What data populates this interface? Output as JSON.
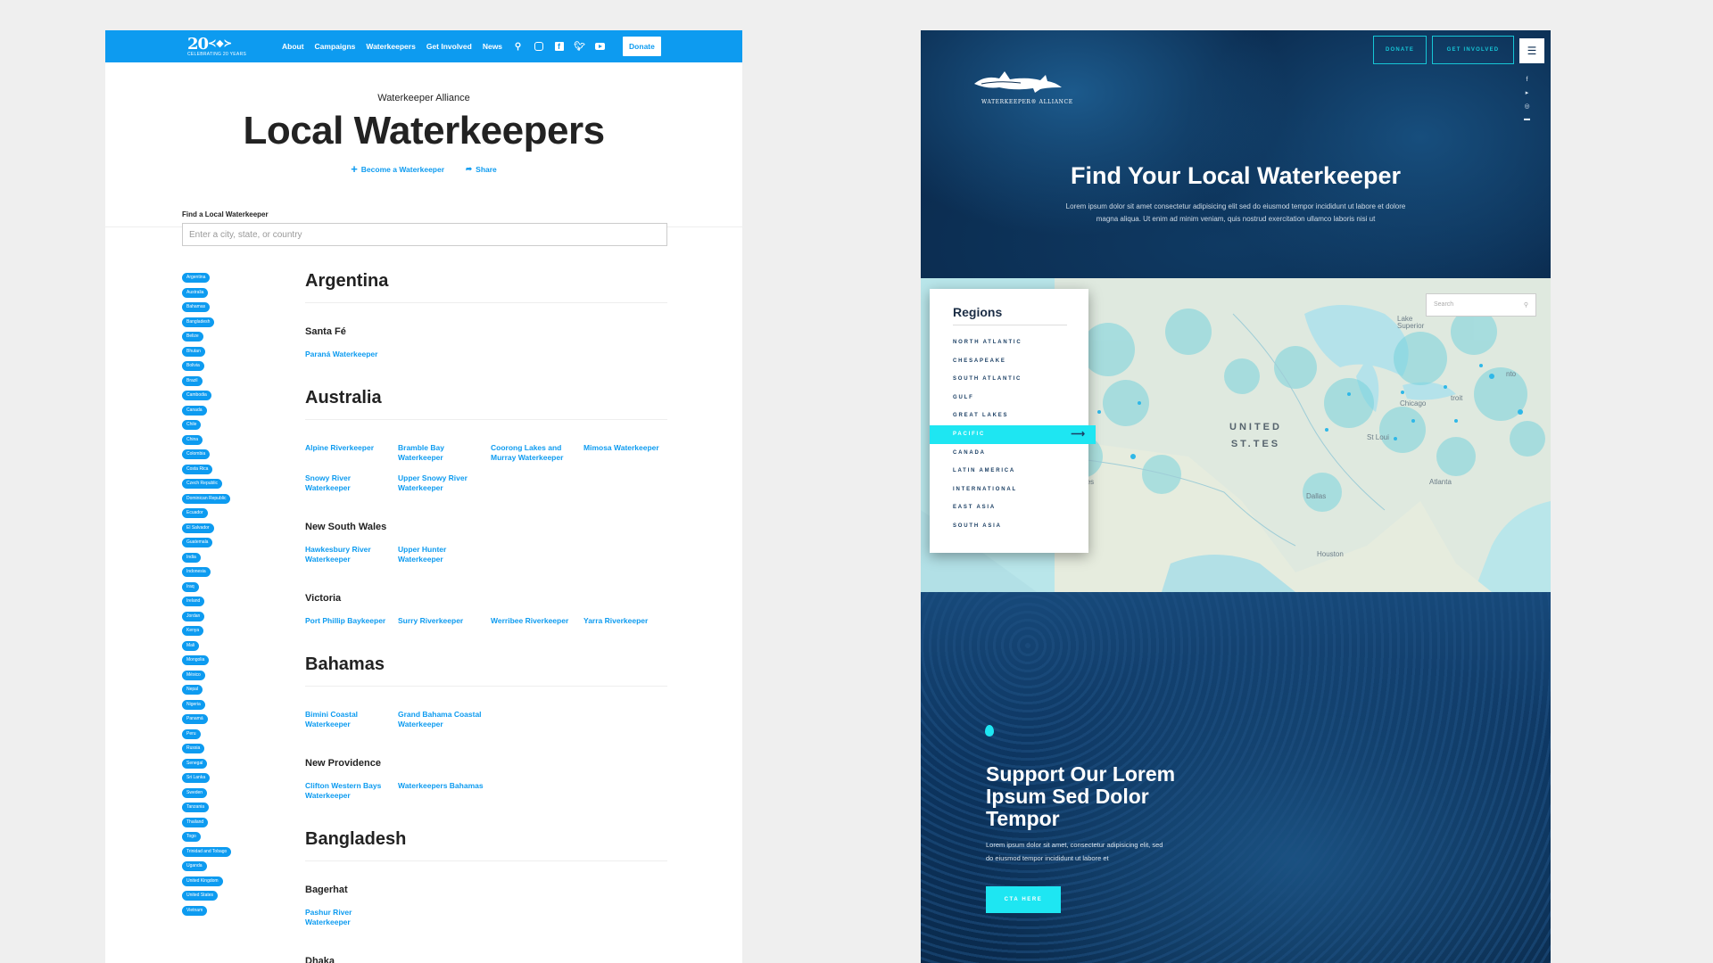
{
  "left_page": {
    "logo": {
      "number": "20",
      "tagline": "CELEBRATING 20 YEARS"
    },
    "nav": {
      "links": [
        "About",
        "Campaigns",
        "Waterkeepers",
        "Get Involved",
        "News"
      ],
      "icons": [
        "search-icon",
        "instagram-icon",
        "facebook-icon",
        "twitter-icon",
        "youtube-icon"
      ],
      "donate_label": "Donate"
    },
    "hero": {
      "kicker": "Waterkeeper Alliance",
      "title": "Local Waterkeepers",
      "become_label": "Become a Waterkeeper",
      "share_label": "Share"
    },
    "search": {
      "label": "Find a Local Waterkeeper",
      "placeholder": "Enter a city, state, or country"
    },
    "country_filters": [
      "Argentina",
      "Australia",
      "Bahamas",
      "Bangladesh",
      "Belize",
      "Bhutan",
      "Bolivia",
      "Brazil",
      "Cambodia",
      "Canada",
      "Chile",
      "China",
      "Colombia",
      "Costa Rica",
      "Czech Republic",
      "Dominican Republic",
      "Ecuador",
      "El Salvador",
      "Guatemala",
      "India",
      "Indonesia",
      "Iraq",
      "Ireland",
      "Jordan",
      "Kenya",
      "Mali",
      "Mongolia",
      "México",
      "Nepal",
      "Nigeria",
      "Panamá",
      "Peru",
      "Russia",
      "Senegal",
      "Sri Lanka",
      "Sweden",
      "Tanzania",
      "Thailand",
      "Togo",
      "Trinidad and Tobago",
      "Uganda",
      "United Kingdom",
      "United States",
      "Vietnam"
    ],
    "countries": [
      {
        "name": "Argentina",
        "regions": [
          {
            "name": "Santa Fé",
            "keepers": [
              "Paraná Waterkeeper"
            ]
          }
        ]
      },
      {
        "name": "Australia",
        "regions": [
          {
            "name": "",
            "keepers": [
              "Alpine Riverkeeper",
              "Bramble Bay Waterkeeper",
              "Coorong Lakes and Murray Waterkeeper",
              "Mimosa Waterkeeper",
              "Snowy River Waterkeeper",
              "Upper Snowy River Waterkeeper"
            ]
          },
          {
            "name": "New South Wales",
            "keepers": [
              "Hawkesbury River Waterkeeper",
              "Upper Hunter Waterkeeper"
            ]
          },
          {
            "name": "Victoria",
            "keepers": [
              "Port Phillip Baykeeper",
              "Surry Riverkeeper",
              "Werribee Riverkeeper",
              "Yarra Riverkeeper"
            ]
          }
        ]
      },
      {
        "name": "Bahamas",
        "regions": [
          {
            "name": "",
            "keepers": [
              "Bimini Coastal Waterkeeper",
              "Grand Bahama Coastal Waterkeeper"
            ]
          },
          {
            "name": "New Providence",
            "keepers": [
              "Clifton Western Bays Waterkeeper",
              "Waterkeepers Bahamas"
            ]
          }
        ]
      },
      {
        "name": "Bangladesh",
        "regions": [
          {
            "name": "Bagerhat",
            "keepers": [
              "Pashur River Waterkeeper"
            ]
          },
          {
            "name": "Dhaka",
            "keepers": []
          }
        ]
      }
    ]
  },
  "right_page": {
    "header": {
      "donate_label": "DONATE",
      "get_involved_label": "GET INVOLVED",
      "menu_icon": "hamburger-icon"
    },
    "social_icons": [
      "facebook-icon",
      "twitter-icon",
      "instagram-icon",
      "youtube-icon"
    ],
    "logo_name": "WATERKEEPER® ALLIANCE",
    "hero": {
      "title": "Find Your Local Waterkeeper",
      "body": "Lorem ipsum dolor sit amet consectetur adipisicing elit sed do eiusmod tempor incididunt ut labore et dolore magna aliqua. Ut enim ad minim veniam, quis nostrud exercitation ullamco laboris nisi ut"
    },
    "map": {
      "search_placeholder": "Search",
      "country_label_line1": "UNITED",
      "country_label_line2": "ST.TES",
      "place_labels": [
        "Lake Superior",
        "Chicago",
        "troit",
        "St Loui",
        "os Angeles",
        "Dallas",
        "Atlanta",
        "Houston",
        "nto"
      ]
    },
    "regions": {
      "title": "Regions",
      "items": [
        "North Atlantic",
        "Chesapeake",
        "South Atlantic",
        "Gulf",
        "Great Lakes",
        "Pacific",
        "Canada",
        "Latin America",
        "International",
        "East Asia",
        "South Asia"
      ],
      "active": "Pacific"
    },
    "cta": {
      "title": "Support Our Lorem Ipsum Sed Dolor Tempor",
      "body": "Lorem ipsum dolor sit amet, consectetur adipisicing elit, sed do eiusmod tempor incididunt ut labore et",
      "button_label": "CTA HERE"
    },
    "colors": {
      "accent": "#1ee6f2",
      "navy": "#0b2c50",
      "brand_blue": "#0d9bf0"
    }
  }
}
